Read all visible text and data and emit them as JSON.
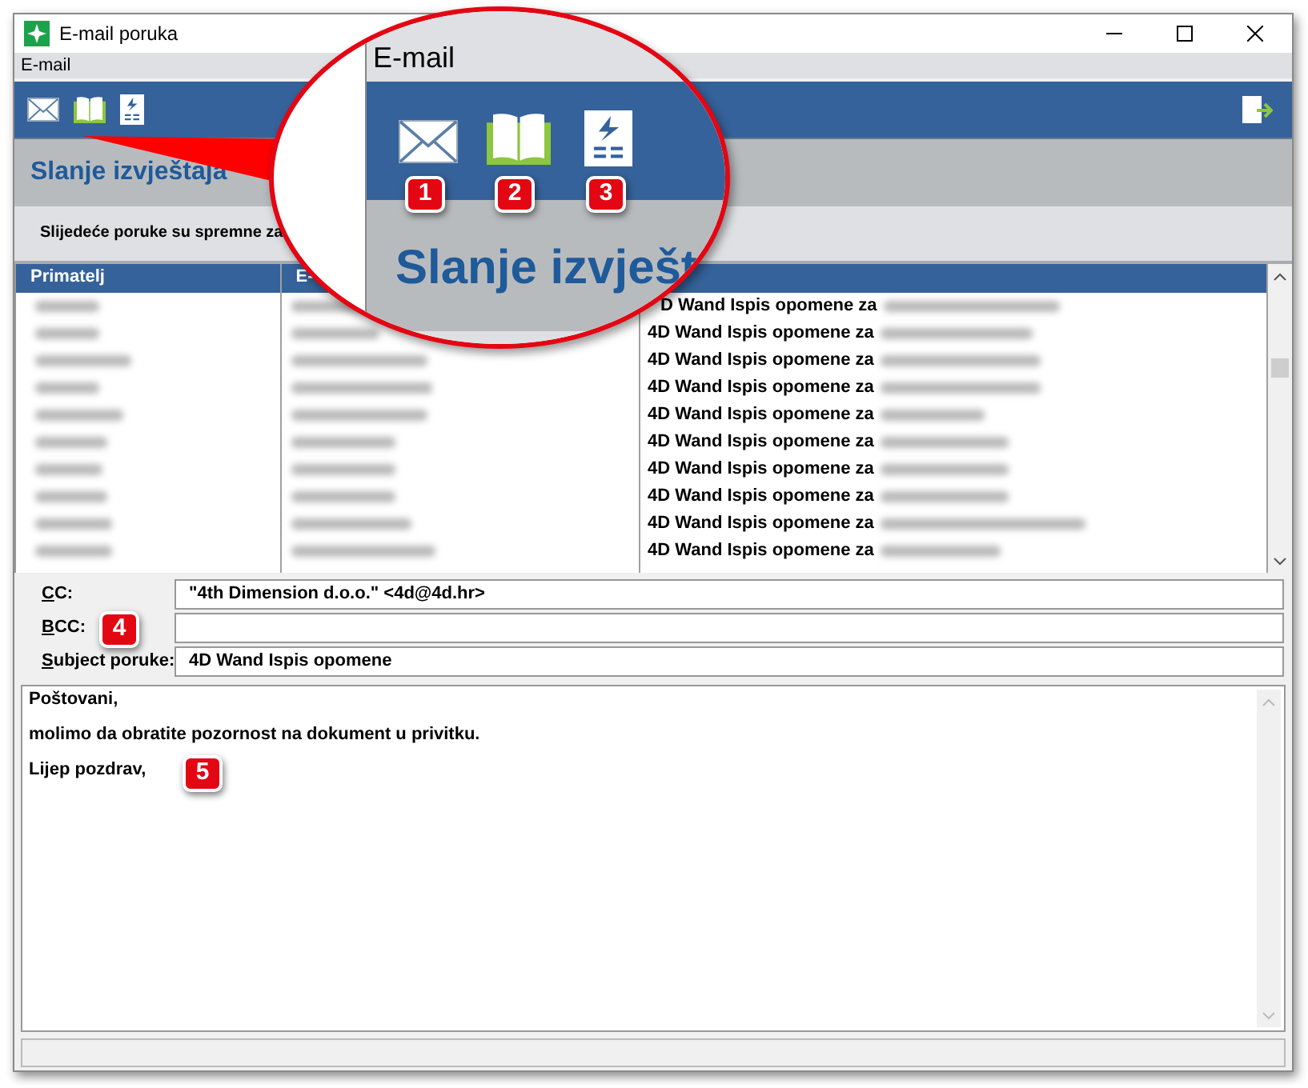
{
  "window": {
    "title": "E-mail poruka"
  },
  "menu": [
    "E-mail"
  ],
  "header": {
    "title": "Slanje izvještaja",
    "subtitle": "Slijedeće poruke su spremne za"
  },
  "table": {
    "columns": [
      "Primatelj",
      "E-"
    ],
    "rows": [
      {
        "kind": "clipped",
        "attachment": "D Wand Ispis opomene za"
      },
      {
        "attachment": "4D Wand Ispis opomene za"
      },
      {
        "attachment": "4D Wand Ispis opomene za"
      },
      {
        "attachment": "4D Wand Ispis opomene za"
      },
      {
        "attachment": "4D Wand Ispis opomene za"
      },
      {
        "attachment": "4D Wand Ispis opomene za"
      },
      {
        "attachment": "4D Wand Ispis opomene za"
      },
      {
        "attachment": "4D Wand Ispis opomene za"
      },
      {
        "attachment": "4D Wand Ispis opomene za"
      },
      {
        "attachment": "4D Wand Ispis opomene za"
      }
    ]
  },
  "form": {
    "fields": [
      {
        "label": "CC:",
        "value": "\"4th Dimension d.o.o.\" <4d@4d.hr>"
      },
      {
        "label": "BCC:"
      },
      {
        "label": "Subject poruke:",
        "value": "4D Wand Ispis opomene"
      }
    ]
  },
  "body": {
    "lines": [
      "Poštovani,",
      "molimo da obratite pozornost na dokument u privitku.",
      "Lijep pozdrav,"
    ]
  },
  "callout": {
    "menu": "E-mail",
    "title": "Slanje izvješt",
    "badges": [
      "1",
      "2",
      "3"
    ]
  },
  "badges": [
    "4",
    "5"
  ]
}
